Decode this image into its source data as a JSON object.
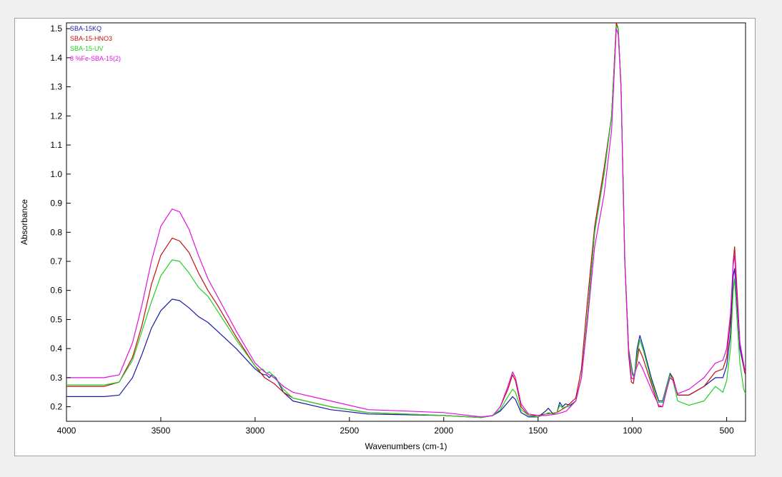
{
  "chart_data": {
    "type": "line",
    "title": "",
    "xlabel": "Wavenumbers (cm-1)",
    "ylabel": "Absorbance",
    "xlim": [
      4000,
      400
    ],
    "ylim": [
      0.15,
      1.52
    ],
    "x_ticks": [
      "4000",
      "3500",
      "3000",
      "2500",
      "2000",
      "1500",
      "1000",
      "500"
    ],
    "x_tick_values": [
      4000,
      3500,
      3000,
      2500,
      2000,
      1500,
      1000,
      500
    ],
    "y_ticks": [
      "0.2",
      "0.3",
      "0.4",
      "0.5",
      "0.6",
      "0.7",
      "0.8",
      "0.9",
      "1.0",
      "1.1",
      "1.2",
      "1.3",
      "1.4",
      "1.5"
    ],
    "y_tick_values": [
      0.2,
      0.3,
      0.4,
      0.5,
      0.6,
      0.7,
      0.8,
      0.9,
      1.0,
      1.1,
      1.2,
      1.3,
      1.4,
      1.5
    ],
    "grid": false,
    "legend_position": "top-left",
    "series": [
      {
        "name": "SBA-15KQ",
        "color": "#1a1aa8",
        "points": [
          [
            4000,
            0.235
          ],
          [
            3800,
            0.235
          ],
          [
            3720,
            0.24
          ],
          [
            3650,
            0.3
          ],
          [
            3600,
            0.38
          ],
          [
            3550,
            0.47
          ],
          [
            3500,
            0.53
          ],
          [
            3440,
            0.57
          ],
          [
            3400,
            0.565
          ],
          [
            3350,
            0.54
          ],
          [
            3300,
            0.51
          ],
          [
            3250,
            0.49
          ],
          [
            3200,
            0.46
          ],
          [
            3100,
            0.4
          ],
          [
            3000,
            0.33
          ],
          [
            2970,
            0.315
          ],
          [
            2955,
            0.31
          ],
          [
            2940,
            0.31
          ],
          [
            2925,
            0.3
          ],
          [
            2910,
            0.31
          ],
          [
            2890,
            0.3
          ],
          [
            2850,
            0.25
          ],
          [
            2800,
            0.22
          ],
          [
            2600,
            0.19
          ],
          [
            2400,
            0.175
          ],
          [
            2000,
            0.17
          ],
          [
            1800,
            0.163
          ],
          [
            1740,
            0.17
          ],
          [
            1700,
            0.185
          ],
          [
            1660,
            0.215
          ],
          [
            1635,
            0.235
          ],
          [
            1620,
            0.225
          ],
          [
            1590,
            0.18
          ],
          [
            1550,
            0.165
          ],
          [
            1500,
            0.165
          ],
          [
            1460,
            0.185
          ],
          [
            1445,
            0.195
          ],
          [
            1420,
            0.175
          ],
          [
            1400,
            0.18
          ],
          [
            1385,
            0.215
          ],
          [
            1370,
            0.2
          ],
          [
            1355,
            0.21
          ],
          [
            1330,
            0.205
          ],
          [
            1300,
            0.22
          ],
          [
            1270,
            0.3
          ],
          [
            1240,
            0.5
          ],
          [
            1200,
            0.8
          ],
          [
            1150,
            1.0
          ],
          [
            1110,
            1.2
          ],
          [
            1085,
            1.51
          ],
          [
            1075,
            1.5
          ],
          [
            1060,
            1.3
          ],
          [
            1040,
            0.7
          ],
          [
            1020,
            0.4
          ],
          [
            1000,
            0.32
          ],
          [
            990,
            0.3
          ],
          [
            975,
            0.4
          ],
          [
            960,
            0.445
          ],
          [
            940,
            0.4
          ],
          [
            900,
            0.3
          ],
          [
            860,
            0.22
          ],
          [
            840,
            0.22
          ],
          [
            815,
            0.28
          ],
          [
            800,
            0.315
          ],
          [
            785,
            0.3
          ],
          [
            760,
            0.24
          ],
          [
            700,
            0.24
          ],
          [
            620,
            0.27
          ],
          [
            560,
            0.3
          ],
          [
            520,
            0.3
          ],
          [
            500,
            0.34
          ],
          [
            480,
            0.45
          ],
          [
            465,
            0.65
          ],
          [
            458,
            0.675
          ],
          [
            445,
            0.55
          ],
          [
            430,
            0.4
          ],
          [
            405,
            0.32
          ],
          [
            400,
            0.31
          ]
        ]
      },
      {
        "name": "SBA-15-HNO3",
        "color": "#c01010",
        "points": [
          [
            4000,
            0.27
          ],
          [
            3800,
            0.27
          ],
          [
            3720,
            0.285
          ],
          [
            3650,
            0.37
          ],
          [
            3600,
            0.48
          ],
          [
            3550,
            0.62
          ],
          [
            3500,
            0.72
          ],
          [
            3440,
            0.78
          ],
          [
            3400,
            0.77
          ],
          [
            3350,
            0.73
          ],
          [
            3300,
            0.66
          ],
          [
            3250,
            0.6
          ],
          [
            3200,
            0.55
          ],
          [
            3100,
            0.44
          ],
          [
            3000,
            0.34
          ],
          [
            2950,
            0.3
          ],
          [
            2900,
            0.28
          ],
          [
            2850,
            0.25
          ],
          [
            2800,
            0.23
          ],
          [
            2600,
            0.2
          ],
          [
            2400,
            0.18
          ],
          [
            2000,
            0.17
          ],
          [
            1800,
            0.163
          ],
          [
            1740,
            0.17
          ],
          [
            1700,
            0.2
          ],
          [
            1660,
            0.26
          ],
          [
            1635,
            0.31
          ],
          [
            1620,
            0.29
          ],
          [
            1590,
            0.2
          ],
          [
            1550,
            0.17
          ],
          [
            1500,
            0.17
          ],
          [
            1460,
            0.175
          ],
          [
            1400,
            0.18
          ],
          [
            1350,
            0.2
          ],
          [
            1300,
            0.23
          ],
          [
            1270,
            0.33
          ],
          [
            1240,
            0.55
          ],
          [
            1200,
            0.82
          ],
          [
            1150,
            1.02
          ],
          [
            1110,
            1.2
          ],
          [
            1085,
            1.52
          ],
          [
            1075,
            1.5
          ],
          [
            1060,
            1.3
          ],
          [
            1040,
            0.7
          ],
          [
            1020,
            0.38
          ],
          [
            1005,
            0.285
          ],
          [
            995,
            0.28
          ],
          [
            980,
            0.34
          ],
          [
            965,
            0.4
          ],
          [
            945,
            0.37
          ],
          [
            900,
            0.28
          ],
          [
            860,
            0.2
          ],
          [
            840,
            0.2
          ],
          [
            815,
            0.27
          ],
          [
            800,
            0.31
          ],
          [
            785,
            0.3
          ],
          [
            760,
            0.24
          ],
          [
            700,
            0.24
          ],
          [
            620,
            0.27
          ],
          [
            560,
            0.32
          ],
          [
            520,
            0.33
          ],
          [
            500,
            0.37
          ],
          [
            480,
            0.5
          ],
          [
            465,
            0.7
          ],
          [
            458,
            0.75
          ],
          [
            445,
            0.6
          ],
          [
            430,
            0.42
          ],
          [
            405,
            0.32
          ],
          [
            400,
            0.31
          ]
        ]
      },
      {
        "name": "SBA-15-UV",
        "color": "#20d020",
        "points": [
          [
            4000,
            0.275
          ],
          [
            3800,
            0.275
          ],
          [
            3720,
            0.285
          ],
          [
            3650,
            0.36
          ],
          [
            3600,
            0.46
          ],
          [
            3550,
            0.56
          ],
          [
            3500,
            0.65
          ],
          [
            3440,
            0.705
          ],
          [
            3400,
            0.7
          ],
          [
            3350,
            0.66
          ],
          [
            3300,
            0.61
          ],
          [
            3250,
            0.58
          ],
          [
            3200,
            0.53
          ],
          [
            3100,
            0.43
          ],
          [
            3000,
            0.34
          ],
          [
            2975,
            0.325
          ],
          [
            2960,
            0.33
          ],
          [
            2940,
            0.315
          ],
          [
            2925,
            0.32
          ],
          [
            2900,
            0.305
          ],
          [
            2850,
            0.26
          ],
          [
            2800,
            0.23
          ],
          [
            2600,
            0.2
          ],
          [
            2400,
            0.18
          ],
          [
            2000,
            0.17
          ],
          [
            1800,
            0.163
          ],
          [
            1740,
            0.17
          ],
          [
            1700,
            0.19
          ],
          [
            1660,
            0.235
          ],
          [
            1635,
            0.26
          ],
          [
            1620,
            0.25
          ],
          [
            1590,
            0.19
          ],
          [
            1550,
            0.17
          ],
          [
            1500,
            0.165
          ],
          [
            1460,
            0.175
          ],
          [
            1445,
            0.18
          ],
          [
            1420,
            0.175
          ],
          [
            1400,
            0.18
          ],
          [
            1385,
            0.205
          ],
          [
            1370,
            0.195
          ],
          [
            1355,
            0.2
          ],
          [
            1330,
            0.2
          ],
          [
            1300,
            0.22
          ],
          [
            1270,
            0.3
          ],
          [
            1240,
            0.5
          ],
          [
            1200,
            0.8
          ],
          [
            1150,
            1.0
          ],
          [
            1110,
            1.2
          ],
          [
            1085,
            1.51
          ],
          [
            1075,
            1.5
          ],
          [
            1060,
            1.3
          ],
          [
            1040,
            0.7
          ],
          [
            1020,
            0.4
          ],
          [
            1000,
            0.31
          ],
          [
            990,
            0.3
          ],
          [
            975,
            0.38
          ],
          [
            960,
            0.43
          ],
          [
            940,
            0.39
          ],
          [
            900,
            0.29
          ],
          [
            860,
            0.215
          ],
          [
            840,
            0.215
          ],
          [
            815,
            0.275
          ],
          [
            800,
            0.31
          ],
          [
            785,
            0.29
          ],
          [
            760,
            0.22
          ],
          [
            700,
            0.205
          ],
          [
            620,
            0.22
          ],
          [
            560,
            0.27
          ],
          [
            520,
            0.25
          ],
          [
            500,
            0.29
          ],
          [
            480,
            0.4
          ],
          [
            465,
            0.6
          ],
          [
            458,
            0.64
          ],
          [
            445,
            0.5
          ],
          [
            430,
            0.35
          ],
          [
            410,
            0.26
          ],
          [
            400,
            0.245
          ]
        ]
      },
      {
        "name": "8 %Fe-SBA-15(2)",
        "color": "#e010e0",
        "points": [
          [
            4000,
            0.3
          ],
          [
            3800,
            0.3
          ],
          [
            3720,
            0.31
          ],
          [
            3650,
            0.42
          ],
          [
            3600,
            0.55
          ],
          [
            3550,
            0.7
          ],
          [
            3500,
            0.82
          ],
          [
            3440,
            0.88
          ],
          [
            3400,
            0.87
          ],
          [
            3350,
            0.81
          ],
          [
            3300,
            0.72
          ],
          [
            3250,
            0.64
          ],
          [
            3200,
            0.58
          ],
          [
            3100,
            0.46
          ],
          [
            3000,
            0.35
          ],
          [
            2950,
            0.32
          ],
          [
            2900,
            0.3
          ],
          [
            2850,
            0.27
          ],
          [
            2800,
            0.25
          ],
          [
            2600,
            0.22
          ],
          [
            2400,
            0.19
          ],
          [
            2200,
            0.185
          ],
          [
            2000,
            0.18
          ],
          [
            1800,
            0.165
          ],
          [
            1740,
            0.17
          ],
          [
            1700,
            0.2
          ],
          [
            1660,
            0.27
          ],
          [
            1635,
            0.32
          ],
          [
            1620,
            0.3
          ],
          [
            1590,
            0.21
          ],
          [
            1550,
            0.175
          ],
          [
            1500,
            0.17
          ],
          [
            1460,
            0.17
          ],
          [
            1400,
            0.175
          ],
          [
            1350,
            0.185
          ],
          [
            1300,
            0.22
          ],
          [
            1270,
            0.3
          ],
          [
            1240,
            0.48
          ],
          [
            1200,
            0.75
          ],
          [
            1150,
            0.93
          ],
          [
            1110,
            1.15
          ],
          [
            1085,
            1.5
          ],
          [
            1075,
            1.48
          ],
          [
            1060,
            1.3
          ],
          [
            1040,
            0.7
          ],
          [
            1020,
            0.4
          ],
          [
            1005,
            0.3
          ],
          [
            995,
            0.295
          ],
          [
            980,
            0.33
          ],
          [
            965,
            0.355
          ],
          [
            945,
            0.33
          ],
          [
            900,
            0.26
          ],
          [
            860,
            0.205
          ],
          [
            840,
            0.2
          ],
          [
            815,
            0.265
          ],
          [
            800,
            0.3
          ],
          [
            785,
            0.29
          ],
          [
            760,
            0.245
          ],
          [
            700,
            0.26
          ],
          [
            620,
            0.3
          ],
          [
            560,
            0.35
          ],
          [
            520,
            0.36
          ],
          [
            500,
            0.4
          ],
          [
            480,
            0.52
          ],
          [
            465,
            0.69
          ],
          [
            458,
            0.72
          ],
          [
            445,
            0.57
          ],
          [
            430,
            0.42
          ],
          [
            405,
            0.33
          ],
          [
            400,
            0.32
          ]
        ]
      }
    ]
  }
}
